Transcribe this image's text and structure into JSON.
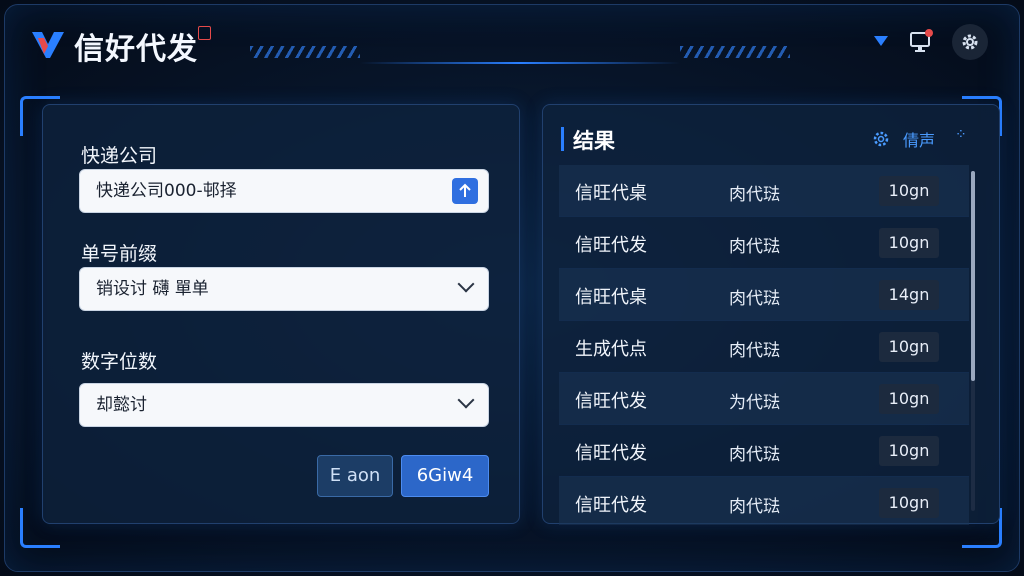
{
  "app": {
    "title": "信好代发",
    "accent": "#2a7fff"
  },
  "header": {
    "icons": [
      "logo-icon",
      "chevron-down-icon",
      "monitor-icon",
      "gear-icon"
    ],
    "notification_dot_color": "#e64a4a"
  },
  "form": {
    "courier": {
      "label": "快递公司",
      "value": "快递公司000-邨择"
    },
    "prefix": {
      "label": "单号前缀",
      "value": "销设讨 礴 單单"
    },
    "digits": {
      "label": "数字位数",
      "value": "却懿讨"
    },
    "cancel_label": "E aon",
    "submit_label": "6Giw4"
  },
  "results": {
    "title": "结果",
    "action_label": "倩声",
    "rows": [
      {
        "name": "信旺代桌",
        "type": "肉代琺",
        "count": "10gn"
      },
      {
        "name": "信旺代发",
        "type": "肉代琺",
        "count": "10gn"
      },
      {
        "name": "信旺代桌",
        "type": "肉代琺",
        "count": "14gn"
      },
      {
        "name": "生成代点",
        "type": "肉代琺",
        "count": "10gn"
      },
      {
        "name": "信旺代发",
        "type": "为代琺",
        "count": "10gn"
      },
      {
        "name": "信旺代发",
        "type": "肉代琺",
        "count": "10gn"
      },
      {
        "name": "信旺代发",
        "type": "肉代琺",
        "count": "10gn"
      }
    ]
  }
}
